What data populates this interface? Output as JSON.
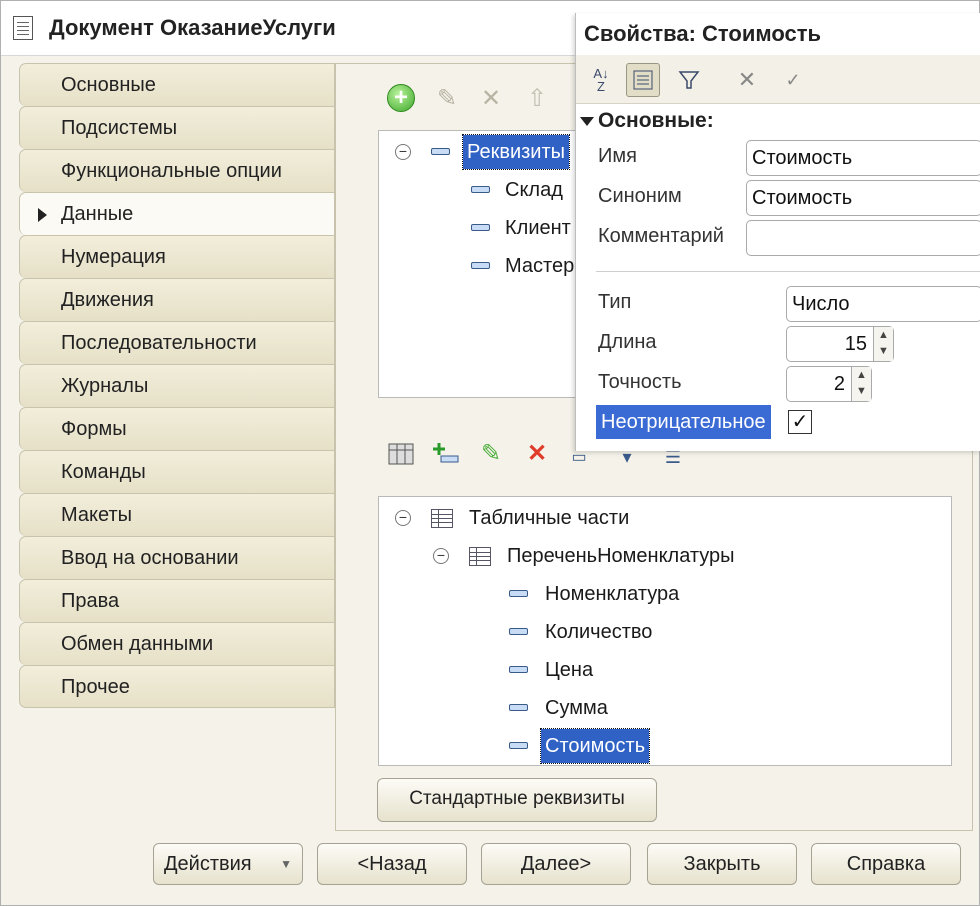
{
  "window": {
    "title": "Документ ОказаниеУслуги"
  },
  "nav": {
    "items": [
      {
        "label": "Основные"
      },
      {
        "label": "Подсистемы"
      },
      {
        "label": "Функциональные опции"
      },
      {
        "label": "Данные",
        "active": true
      },
      {
        "label": "Нумерация"
      },
      {
        "label": "Движения"
      },
      {
        "label": "Последовательности"
      },
      {
        "label": "Журналы"
      },
      {
        "label": "Формы"
      },
      {
        "label": "Команды"
      },
      {
        "label": "Макеты"
      },
      {
        "label": "Ввод на основании"
      },
      {
        "label": "Права"
      },
      {
        "label": "Обмен данными"
      },
      {
        "label": "Прочее"
      }
    ]
  },
  "attributes_tree": {
    "root": "Реквизиты",
    "items": [
      "Склад",
      "Клиент",
      "Мастер"
    ]
  },
  "tabular_tree": {
    "root": "Табличные части",
    "table": "ПереченьНоменклатуры",
    "items": [
      "Номенклатура",
      "Количество",
      "Цена",
      "Сумма",
      "Стоимость"
    ],
    "selected": "Стоимость"
  },
  "buttons": {
    "standard_attributes": "Стандартные реквизиты",
    "actions": "Действия",
    "back": "<Назад",
    "next": "Далее>",
    "close": "Закрыть",
    "help": "Справка"
  },
  "properties": {
    "title": "Свойства: Стоимость",
    "section": "Основные:",
    "name_label": "Имя",
    "name_value": "Стоимость",
    "synonym_label": "Синоним",
    "synonym_value": "Стоимость",
    "comment_label": "Комментарий",
    "comment_value": "",
    "type_label": "Тип",
    "type_value": "Число",
    "length_label": "Длина",
    "length_value": "15",
    "precision_label": "Точность",
    "precision_value": "2",
    "nonnegative_label": "Неотрицательное",
    "nonnegative_checked": true
  },
  "colors": {
    "selection": "#2f62c4",
    "tab_bg": "#e6e0c7",
    "window_bg": "#f4f2e9"
  }
}
